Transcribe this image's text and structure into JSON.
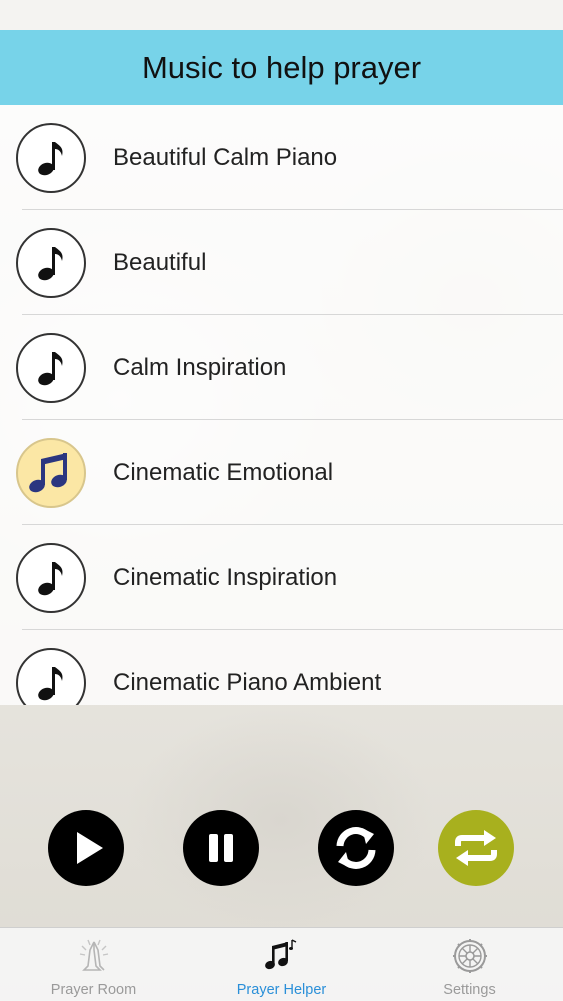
{
  "header": {
    "title": "Music to help prayer"
  },
  "tracks": [
    {
      "title": "Beautiful Calm Piano",
      "active": false
    },
    {
      "title": "Beautiful",
      "active": false
    },
    {
      "title": "Calm Inspiration",
      "active": false
    },
    {
      "title": "Cinematic Emotional",
      "active": true
    },
    {
      "title": "Cinematic Inspiration",
      "active": false
    },
    {
      "title": "Cinematic Piano Ambient",
      "active": false
    }
  ],
  "controls": {
    "play_icon": "play-icon",
    "pause_icon": "pause-icon",
    "refresh_icon": "refresh-icon",
    "repeat_icon": "repeat-icon",
    "repeat_color": "#a8b01e"
  },
  "tabbar": {
    "tabs": [
      {
        "label": "Prayer Room",
        "icon": "praying-hands-icon"
      },
      {
        "label": "Prayer Helper",
        "icon": "music-notes-icon"
      },
      {
        "label": "Settings",
        "icon": "gear-icon"
      }
    ],
    "active_index": 1,
    "active_color": "#2a8fd8"
  },
  "colors": {
    "header": "#77d3e9",
    "active_track": "#fbe7a5"
  }
}
